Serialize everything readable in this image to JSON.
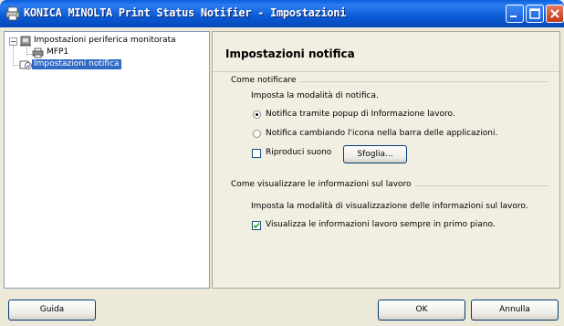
{
  "window": {
    "title": "KONICA MINOLTA Print Status Notifier - Impostazioni"
  },
  "tree": {
    "root_label": "Impostazioni periferica monitorata",
    "child_label": "MFP1",
    "selected_label": "Impostazioni notifica"
  },
  "settings": {
    "title": "Impostazioni notifica",
    "notify_group": {
      "title": "Come notificare",
      "description": "Imposta la modalità di notifica.",
      "options": [
        {
          "label": "Notifica tramite popup di Informazione lavoro.",
          "selected": true
        },
        {
          "label": "Notifica cambiando l'icona nella barra delle applicazioni.",
          "selected": false
        }
      ],
      "sound_label": "Riproduci suono",
      "sound_checked": false,
      "browse_label": "Sfoglia..."
    },
    "display_group": {
      "title": "Come visualizzare le informazioni sul lavoro",
      "description": "Imposta la modalità di visualizzazione delle informazioni sul lavoro.",
      "topmost_label": "Visualizza le informazioni lavoro sempre in primo piano.",
      "topmost_checked": true
    }
  },
  "buttons": {
    "help": "Guida",
    "ok": "OK",
    "cancel": "Annulla"
  }
}
